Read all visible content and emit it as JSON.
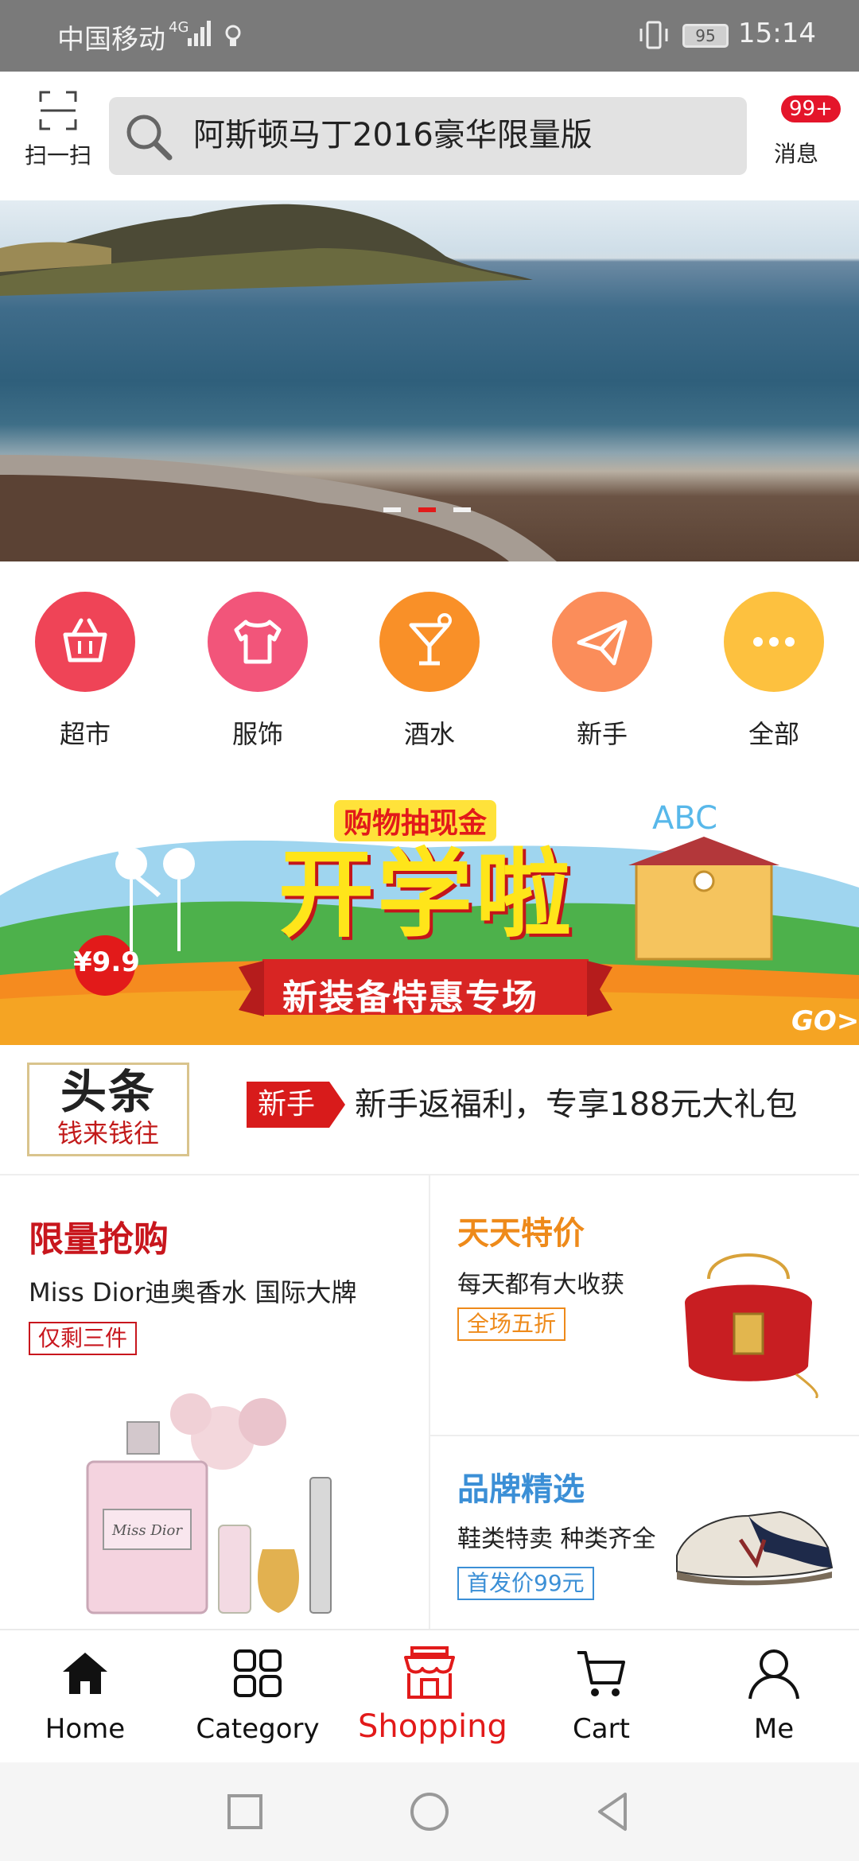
{
  "status_bar": {
    "carrier": "中国移动",
    "network": "4G",
    "battery": "95",
    "time": "15:14"
  },
  "header": {
    "scan_label": "扫一扫",
    "search_text": "阿斯顿马丁2016豪华限量版",
    "message_badge": "99+",
    "message_label": "消息"
  },
  "banner": {
    "dot_count": 3,
    "active_dot": 2
  },
  "categories": [
    {
      "label": "超市",
      "icon": "basket-icon",
      "color": "#ef4457"
    },
    {
      "label": "服饰",
      "icon": "shirt-icon",
      "color": "#f2557a"
    },
    {
      "label": "酒水",
      "icon": "cocktail-icon",
      "color": "#f99028"
    },
    {
      "label": "新手",
      "icon": "paper-plane-icon",
      "color": "#fb8d5a"
    },
    {
      "label": "全部",
      "icon": "more-dots-icon",
      "color": "#fdc13f"
    }
  ],
  "school_banner": {
    "top_text": "购物抽现金",
    "main_text": "开学啦",
    "ribbon_text": "新装备特惠专场",
    "ribbon_highlight": "特惠",
    "price_badge": "¥9.9",
    "abc_text": "ABC",
    "go_text": "GO>"
  },
  "headline": {
    "logo_big": "头条",
    "logo_small": "钱来钱往",
    "tag": "新手",
    "news": "新手返福利，专享188元大礼包"
  },
  "promo": {
    "flash": {
      "title": "限量抢购",
      "subtitle": "Miss Dior迪奥香水 国际大牌",
      "tag": "仅剩三件",
      "color": "#c8161d",
      "product_label": "Miss Dior"
    },
    "daily": {
      "title": "天天特价",
      "subtitle": "每天都有大收获",
      "tag": "全场五折",
      "color": "#ee8a1a"
    },
    "brand": {
      "title": "品牌精选",
      "subtitle": "鞋类特卖 种类齐全",
      "tag": "首发价99元",
      "color": "#3b8fd6"
    }
  },
  "bottom_nav": [
    {
      "label": "Home",
      "icon": "home-icon",
      "active": false
    },
    {
      "label": "Category",
      "icon": "grid-icon",
      "active": false
    },
    {
      "label": "Shopping",
      "icon": "store-icon",
      "active": true
    },
    {
      "label": "Cart",
      "icon": "cart-icon",
      "active": false
    },
    {
      "label": "Me",
      "icon": "person-icon",
      "active": false
    }
  ],
  "colors": {
    "accent": "#e21a1a",
    "status_bar": "#7a7a7a"
  }
}
